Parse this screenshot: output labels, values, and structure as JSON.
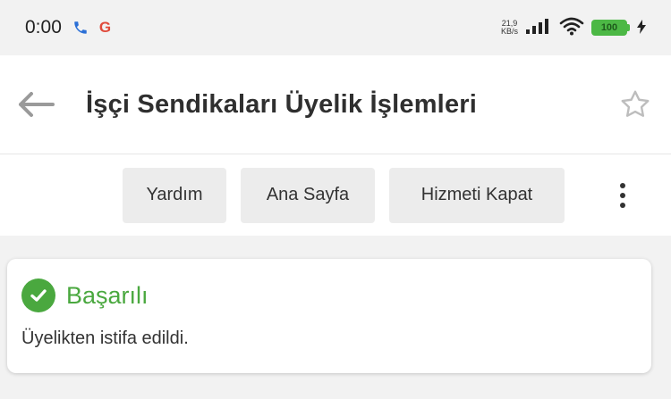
{
  "status_bar": {
    "time": "0:00",
    "google_letter": "G",
    "net_speed_value": "21,9",
    "net_speed_unit": "KB/s",
    "battery_level": "100"
  },
  "header": {
    "title": "İşçi Sendikaları Üyelik İşlemleri"
  },
  "actions": {
    "help_label": "Yardım",
    "home_label": "Ana Sayfa",
    "close_service_label": "Hizmeti Kapat"
  },
  "alert": {
    "title": "Başarılı",
    "message": "Üyelikten istifa edildi."
  },
  "colors": {
    "success": "#4aa83f",
    "battery": "#4cb845",
    "button_bg": "#ececec"
  },
  "icons": [
    "phone-icon",
    "google-icon",
    "signal-icon",
    "wifi-icon",
    "battery-icon",
    "charging-icon",
    "back-arrow-icon",
    "star-icon",
    "more-vertical-icon",
    "check-circle-icon"
  ]
}
